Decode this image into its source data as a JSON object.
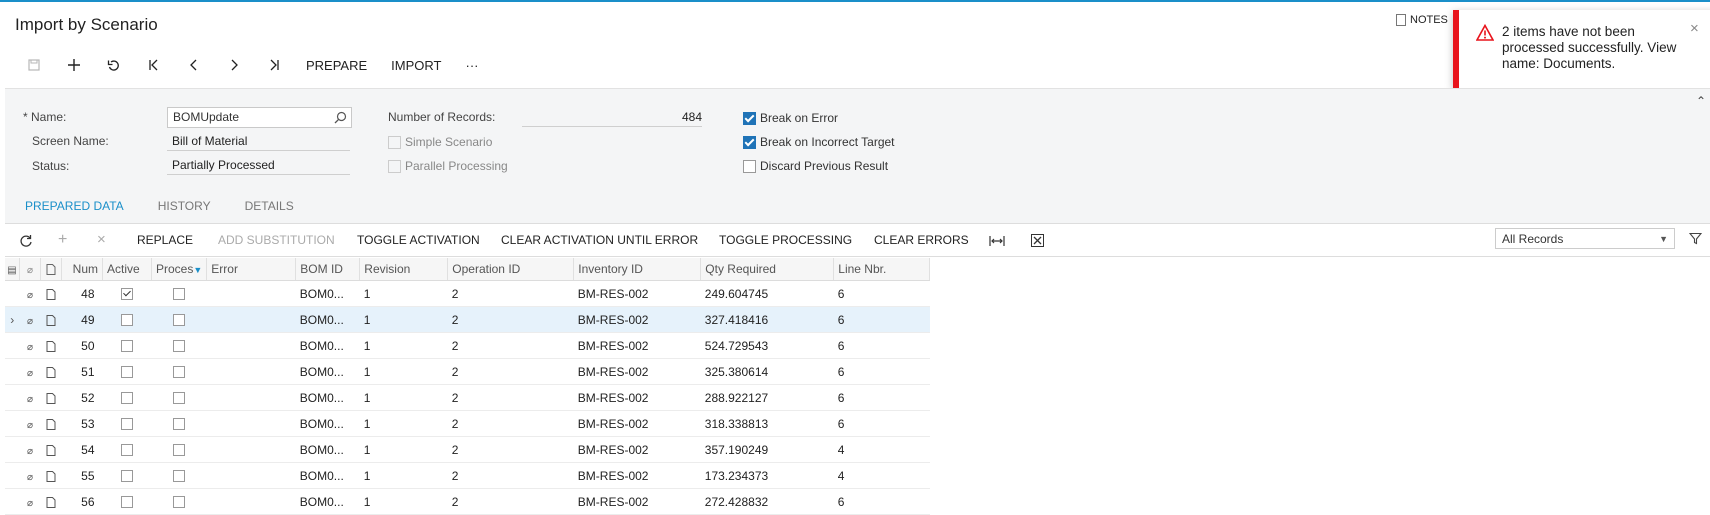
{
  "page": {
    "title": "Import by Scenario",
    "notes_label": "NOTES"
  },
  "toolbar": {
    "prepare_label": "PREPARE",
    "import_label": "IMPORT",
    "more_label": "···"
  },
  "toast": {
    "message": "2 items have not been processed successfully. View name: Documents.",
    "close_label": "×"
  },
  "form": {
    "name_label": "* Name:",
    "name_value": "BOMUpdate",
    "screen_name_label": "Screen Name:",
    "screen_name_value": "Bill of Material",
    "status_label": "Status:",
    "status_value": "Partially Processed",
    "num_records_label": "Number of Records:",
    "num_records_value": "484",
    "simple_scenario_label": "Simple Scenario",
    "parallel_processing_label": "Parallel Processing",
    "break_on_error_label": "Break on Error",
    "break_on_incorrect_target_label": "Break on Incorrect Target",
    "discard_previous_result_label": "Discard Previous Result"
  },
  "tabs": [
    "PREPARED DATA",
    "HISTORY",
    "DETAILS"
  ],
  "grid_toolbar": {
    "replace": "REPLACE",
    "add_substitution": "ADD SUBSTITUTION",
    "toggle_activation": "TOGGLE ACTIVATION",
    "clear_activation": "CLEAR ACTIVATION UNTIL ERROR",
    "toggle_processing": "TOGGLE PROCESSING",
    "clear_errors": "CLEAR ERRORS",
    "filter_value": "All Records"
  },
  "grid": {
    "columns": [
      "Num",
      "Active",
      "Proces",
      "Error",
      "BOM ID",
      "Revision",
      "Operation ID",
      "Inventory ID",
      "Qty Required",
      "Line Nbr."
    ],
    "rows": [
      {
        "num": "48",
        "active": true,
        "bom": "BOM0...",
        "rev": "1",
        "op": "2",
        "inv": "BM-RES-002",
        "qty": "249.604745",
        "line": "6"
      },
      {
        "num": "49",
        "active": false,
        "bom": "BOM0...",
        "rev": "1",
        "op": "2",
        "inv": "BM-RES-002",
        "qty": "327.418416",
        "line": "6"
      },
      {
        "num": "50",
        "active": false,
        "bom": "BOM0...",
        "rev": "1",
        "op": "2",
        "inv": "BM-RES-002",
        "qty": "524.729543",
        "line": "6"
      },
      {
        "num": "51",
        "active": false,
        "bom": "BOM0...",
        "rev": "1",
        "op": "2",
        "inv": "BM-RES-002",
        "qty": "325.380614",
        "line": "6"
      },
      {
        "num": "52",
        "active": false,
        "bom": "BOM0...",
        "rev": "1",
        "op": "2",
        "inv": "BM-RES-002",
        "qty": "288.922127",
        "line": "6"
      },
      {
        "num": "53",
        "active": false,
        "bom": "BOM0...",
        "rev": "1",
        "op": "2",
        "inv": "BM-RES-002",
        "qty": "318.338813",
        "line": "6"
      },
      {
        "num": "54",
        "active": false,
        "bom": "BOM0...",
        "rev": "1",
        "op": "2",
        "inv": "BM-RES-002",
        "qty": "357.190249",
        "line": "4"
      },
      {
        "num": "55",
        "active": false,
        "bom": "BOM0...",
        "rev": "1",
        "op": "2",
        "inv": "BM-RES-002",
        "qty": "173.234373",
        "line": "4"
      },
      {
        "num": "56",
        "active": false,
        "bom": "BOM0...",
        "rev": "1",
        "op": "2",
        "inv": "BM-RES-002",
        "qty": "272.428832",
        "line": "6"
      }
    ]
  },
  "colors": {
    "accent": "#1a8fc9",
    "error": "#e8141c",
    "checkbox": "#1f73b7"
  }
}
